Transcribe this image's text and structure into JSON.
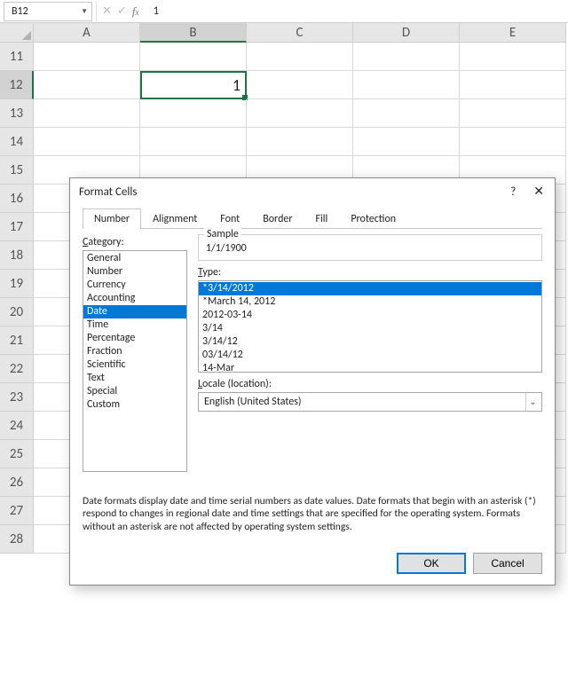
{
  "formula_bar": {
    "name_box": "B12",
    "value": "1"
  },
  "grid": {
    "columns": [
      "A",
      "B",
      "C",
      "D",
      "E"
    ],
    "active_col": "B",
    "rows": [
      "11",
      "12",
      "13",
      "14",
      "15",
      "16",
      "17",
      "18",
      "19",
      "20",
      "21",
      "22",
      "23",
      "24",
      "25",
      "26",
      "27",
      "28"
    ],
    "active_row": "12",
    "active_cell_value": "1"
  },
  "dialog": {
    "title": "Format Cells",
    "help": "?",
    "tabs": [
      "Number",
      "Alignment",
      "Font",
      "Border",
      "Fill",
      "Protection"
    ],
    "active_tab": "Number",
    "category_label": "Category:",
    "categories": [
      "General",
      "Number",
      "Currency",
      "Accounting",
      "Date",
      "Time",
      "Percentage",
      "Fraction",
      "Scientific",
      "Text",
      "Special",
      "Custom"
    ],
    "selected_category": "Date",
    "sample_label": "Sample",
    "sample_value": "1/1/1900",
    "type_label": "Type:",
    "types": [
      "*3/14/2012",
      "*March 14, 2012",
      "2012-03-14",
      "3/14",
      "3/14/12",
      "03/14/12",
      "14-Mar"
    ],
    "selected_type": "*3/14/2012",
    "locale_label": "Locale (location):",
    "locale_value": "English (United States)",
    "description": "Date formats display date and time serial numbers as date values.  Date formats that begin with an asterisk (*) respond to changes in regional date and time settings that are specified for the operating system. Formats without an asterisk are not affected by operating system settings.",
    "buttons": {
      "ok": "OK",
      "cancel": "Cancel"
    }
  }
}
